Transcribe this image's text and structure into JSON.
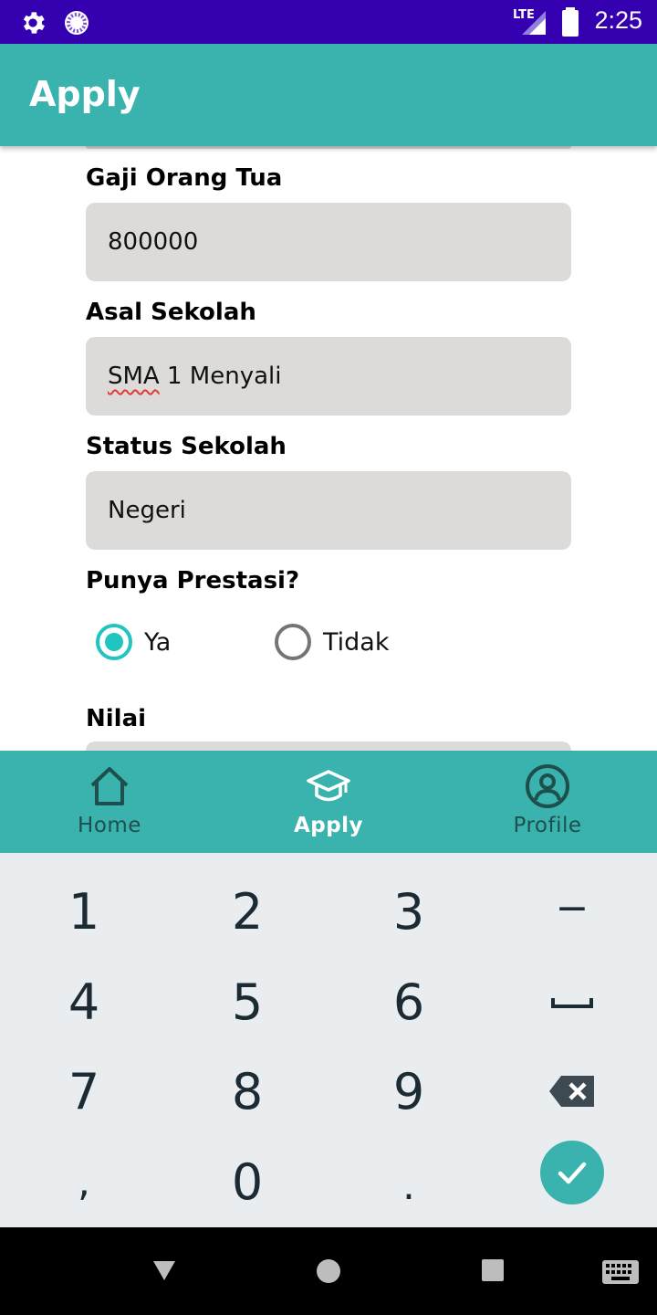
{
  "status_bar": {
    "time": "2:25",
    "network": "LTE",
    "icons": [
      "settings-icon",
      "sync-icon",
      "lte-signal-icon",
      "battery-icon"
    ]
  },
  "app_bar": {
    "title": "Apply"
  },
  "form": {
    "gaji_orang_tua": {
      "label": "Gaji Orang Tua",
      "value": "800000"
    },
    "asal_sekolah": {
      "label": "Asal Sekolah",
      "value_marked": "SMA",
      "value_rest": " 1 Menyali"
    },
    "status_sekolah": {
      "label": "Status Sekolah",
      "value": "Negeri"
    },
    "prestasi": {
      "label": "Punya Prestasi?",
      "options": [
        "Ya",
        "Tidak"
      ],
      "selected": "Ya"
    },
    "nilai": {
      "label": "Nilai"
    }
  },
  "bottom_nav": {
    "items": [
      {
        "label": "Home",
        "icon": "home-icon"
      },
      {
        "label": "Apply",
        "icon": "graduation-cap-icon",
        "active": true
      },
      {
        "label": "Profile",
        "icon": "profile-icon"
      }
    ]
  },
  "keypad": {
    "keys": [
      "1",
      "2",
      "3",
      "−",
      "4",
      "5",
      "6",
      "␣",
      "7",
      "8",
      "9",
      "⌫",
      ",",
      "0",
      ".",
      "✓"
    ]
  },
  "colors": {
    "status_bar": "#3500b0",
    "accent": "#3ab3ae",
    "radio_selected": "#20c5c0",
    "field_bg": "#dcdbd9",
    "keypad_bg": "#e9edf0"
  }
}
